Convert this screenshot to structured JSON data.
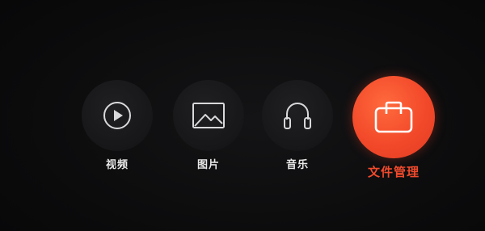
{
  "menu": {
    "items": [
      {
        "label": "视频",
        "icon": "play-icon",
        "selected": false
      },
      {
        "label": "图片",
        "icon": "image-icon",
        "selected": false
      },
      {
        "label": "音乐",
        "icon": "headphones-icon",
        "selected": false
      },
      {
        "label": "文件管理",
        "icon": "briefcase-icon",
        "selected": true
      }
    ]
  },
  "colors": {
    "background": "#0a0a0b",
    "icon_circle": "#1c1c1f",
    "icon_stroke": "#d9d9dc",
    "accent": "#f04a2c",
    "label": "#e9e9ea"
  }
}
